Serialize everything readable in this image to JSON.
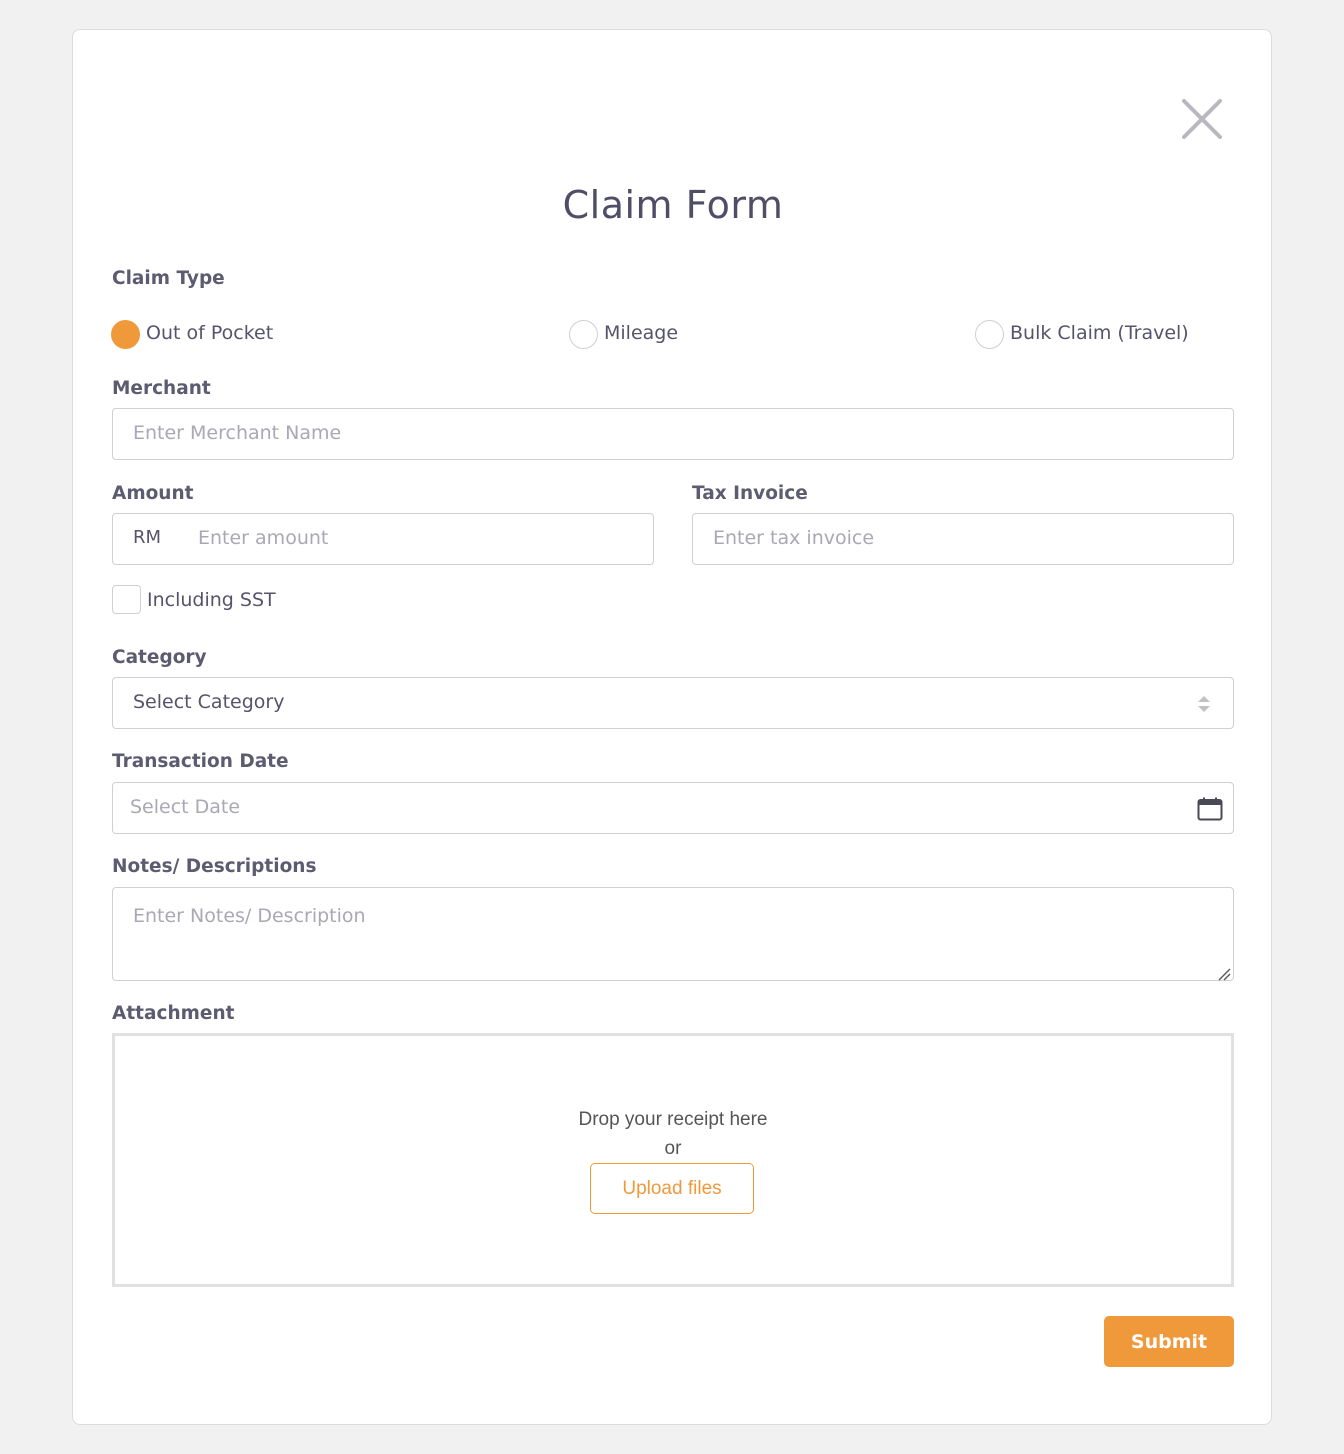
{
  "form": {
    "title": "Claim Form",
    "claim_type": {
      "label": "Claim Type",
      "options": [
        {
          "label": "Out of Pocket",
          "selected": true
        },
        {
          "label": "Mileage",
          "selected": false
        },
        {
          "label": "Bulk Claim (Travel)",
          "selected": false
        }
      ]
    },
    "merchant": {
      "label": "Merchant",
      "placeholder": "Enter Merchant Name"
    },
    "amount": {
      "label": "Amount",
      "prefix": "RM",
      "placeholder": "Enter amount"
    },
    "tax_invoice": {
      "label": "Tax Invoice",
      "placeholder": "Enter tax invoice"
    },
    "sst": {
      "label": "Including SST",
      "checked": false
    },
    "category": {
      "label": "Category",
      "selected": "Select Category"
    },
    "transaction_date": {
      "label": "Transaction Date",
      "placeholder": "Select Date"
    },
    "notes": {
      "label": "Notes/ Descriptions",
      "placeholder": "Enter Notes/ Description"
    },
    "attachment": {
      "label": "Attachment",
      "drop_text": "Drop your receipt here",
      "or_text": "or",
      "upload_label": "Upload files"
    },
    "submit_label": "Submit"
  },
  "colors": {
    "accent": "#f0993b",
    "text": "#55546a",
    "placeholder": "#a9a8b4",
    "border": "#cfcfd4",
    "background": "#f1f1f1"
  }
}
